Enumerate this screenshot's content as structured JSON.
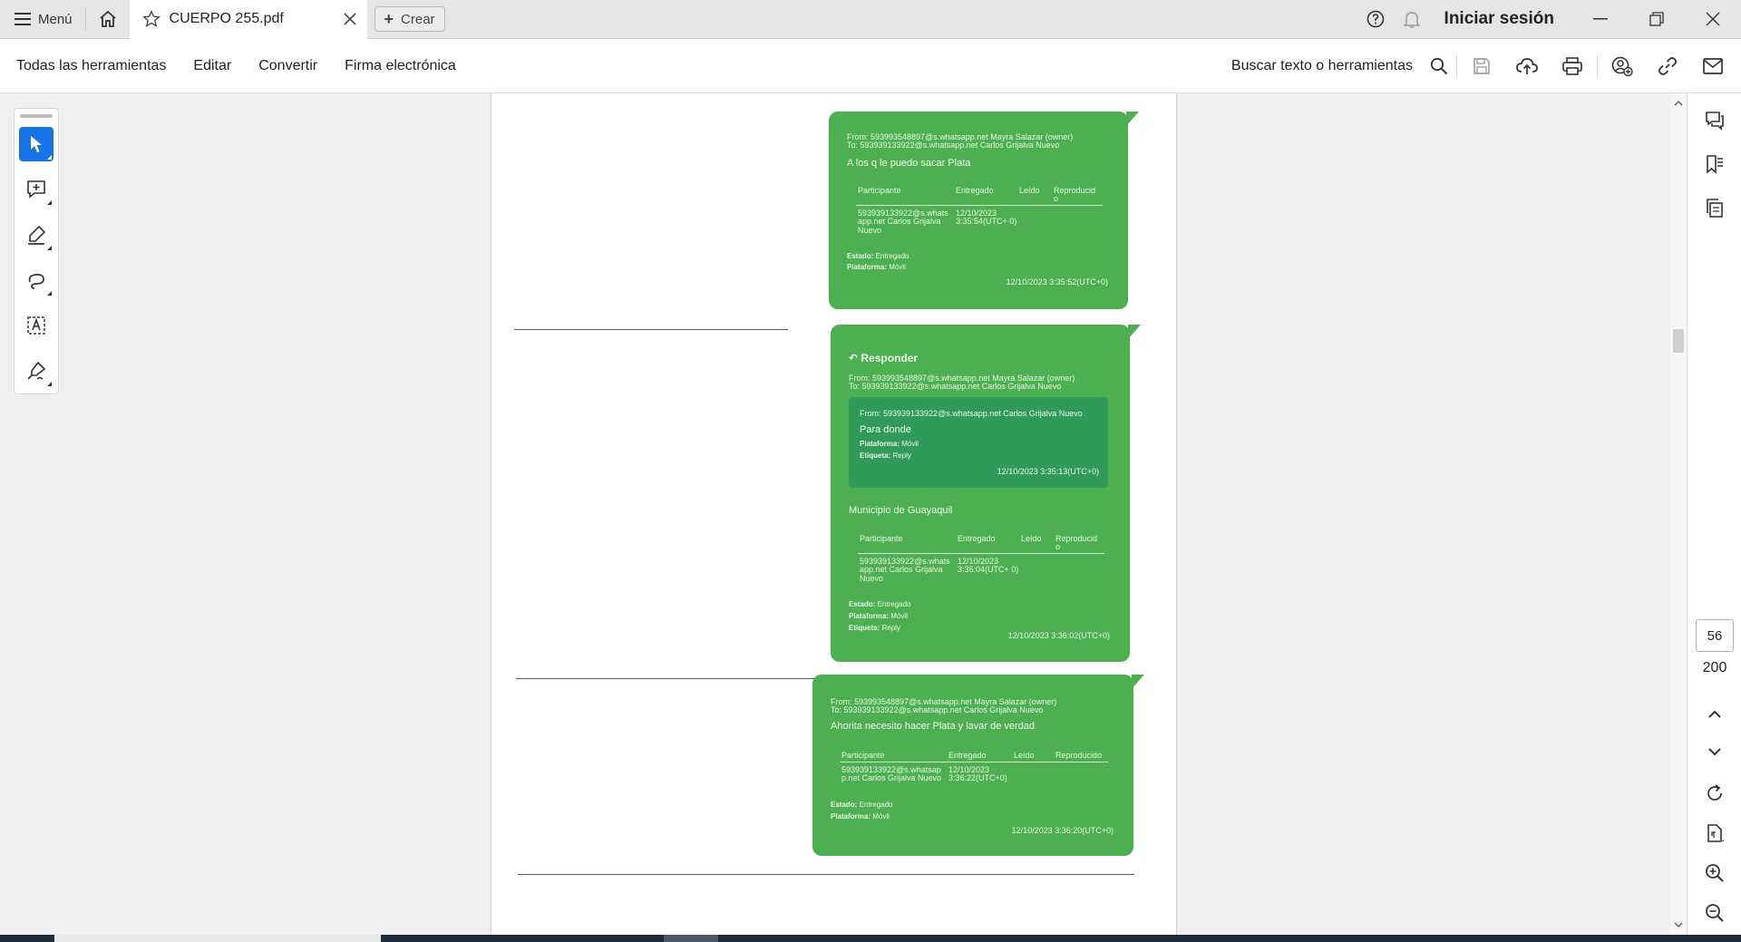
{
  "tabbar": {
    "menu_label": "Menú",
    "tab_title": "CUERPO 255.pdf",
    "create_label": "Crear",
    "signin_label": "Iniciar sesión"
  },
  "toolbar": {
    "items": [
      "Todas las herramientas",
      "Editar",
      "Convertir",
      "Firma electrónica"
    ],
    "search_label": "Buscar texto o herramientas"
  },
  "pagination": {
    "current": "56",
    "total": "200"
  },
  "document": {
    "msg1": {
      "from": "From: 593993548897@s.whatsapp.net Mayra Salazar (owner)",
      "to": "To: 593939133922@s.whatsapp.net Carlos Grijalva Nuevo",
      "text": "A los q le puedo sacar Plata",
      "headers": [
        "Participante",
        "Entregado",
        "Leído",
        "Reproducid o"
      ],
      "participant": "593939133922@s.whats app.net Carlos Grijalva Nuevo",
      "delivered": "12/10/2023 3:35:54(UTC+ 0)",
      "estado_label": "Estado:",
      "estado_value": "Entregado",
      "plataforma_label": "Plataforma:",
      "plataforma_value": "Móvil",
      "time": "12/10/2023 3:35:52(UTC+0)"
    },
    "msg2": {
      "reply_label": "Responder",
      "from": "From: 593993548897@s.whatsapp.net Mayra Salazar (owner)",
      "to": "To: 593939133922@s.whatsapp.net Carlos Grijalva Nuevo",
      "quote_from": "From: 593939133922@s.whatsapp.net Carlos Grijalva Nuevo",
      "quote_text": "Para donde",
      "quote_plataforma_label": "Plataforma:",
      "quote_plataforma_value": "Móvil",
      "quote_etiqueta_label": "Etiqueta:",
      "quote_etiqueta_value": "Reply",
      "quote_time": "12/10/2023 3:35:13(UTC+0)",
      "text": "Municipio de Guayaquil",
      "headers": [
        "Participante",
        "Entregado",
        "Leído",
        "Reproducid o"
      ],
      "participant": "593939133922@s.whats app.net Carlos Grijalva Nuevo",
      "delivered": "12/10/2023 3:36:04(UTC+ 0)",
      "estado_label": "Estado:",
      "estado_value": "Entregado",
      "plataforma_label": "Plataforma:",
      "plataforma_value": "Móvil",
      "etiqueta_label": "Etiqueta:",
      "etiqueta_value": "Reply",
      "time": "12/10/2023 3:36:02(UTC+0)"
    },
    "msg3": {
      "from": "From: 593993548897@s.whatsapp.net Mayra Salazar (owner)",
      "to": "To: 593939133922@s.whatsapp.net Carlos Grijalva Nuevo",
      "text": "Ahorita necesito hacer Plata y lavar de verdad",
      "headers": [
        "Participante",
        "Entregado",
        "Leído",
        "Reproducido"
      ],
      "participant": "593939133922@s.whatsap p.net Carlos Grijalva Nuevo",
      "delivered": "12/10/2023 3:36:22(UTC+0)",
      "estado_label": "Estado:",
      "estado_value": "Entregado",
      "plataforma_label": "Plataforma:",
      "plataforma_value": "Móvil",
      "time": "12/10/2023 3:36:20(UTC+0)"
    }
  },
  "colors": {
    "accent": "#1473e6",
    "bubble_green": "#4caf50",
    "quote_green": "#2f9a5a"
  }
}
